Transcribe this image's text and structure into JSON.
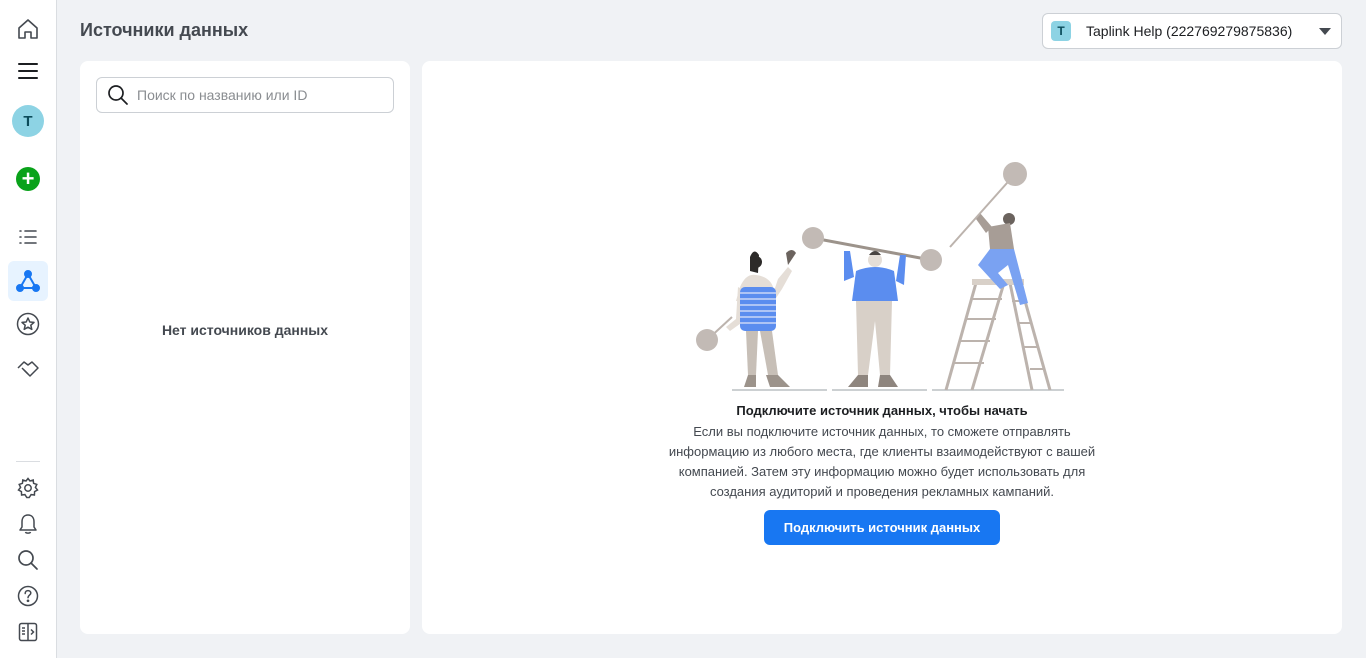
{
  "page": {
    "title": "Источники данных"
  },
  "account": {
    "badge": "T",
    "name": "Taplink Help (222769279875836)"
  },
  "rail": {
    "avatar_letter": "T",
    "top_items": [
      "home-icon",
      "menu-icon",
      "avatar",
      "create-icon",
      "list-icon",
      "data-sources-icon",
      "star-icon",
      "handshake-icon"
    ],
    "bottom_items": [
      "settings-icon",
      "bell-icon",
      "search-icon",
      "help-icon",
      "panel-toggle-icon"
    ],
    "active_item": "data-sources-icon"
  },
  "left_panel": {
    "search_placeholder": "Поиск по названию или ID",
    "search_value": "",
    "empty_text": "Нет источников данных"
  },
  "right_panel": {
    "title": "Подключите источник данных, чтобы начать",
    "body_lines": [
      "Если вы подключите источник данных, то сможете отправлять",
      "информацию из любого места, где клиенты взаимодействуют с вашей",
      "компанией. Затем эту информацию можно будет использовать для",
      "создания аудиторий и проведения рекламных кампаний."
    ],
    "button_label": "Подключить источник данных"
  },
  "colors": {
    "accent": "#1877f2",
    "create_green": "#09a21a",
    "avatar_bg": "#8dd3e4",
    "background": "#f0f2f5"
  }
}
